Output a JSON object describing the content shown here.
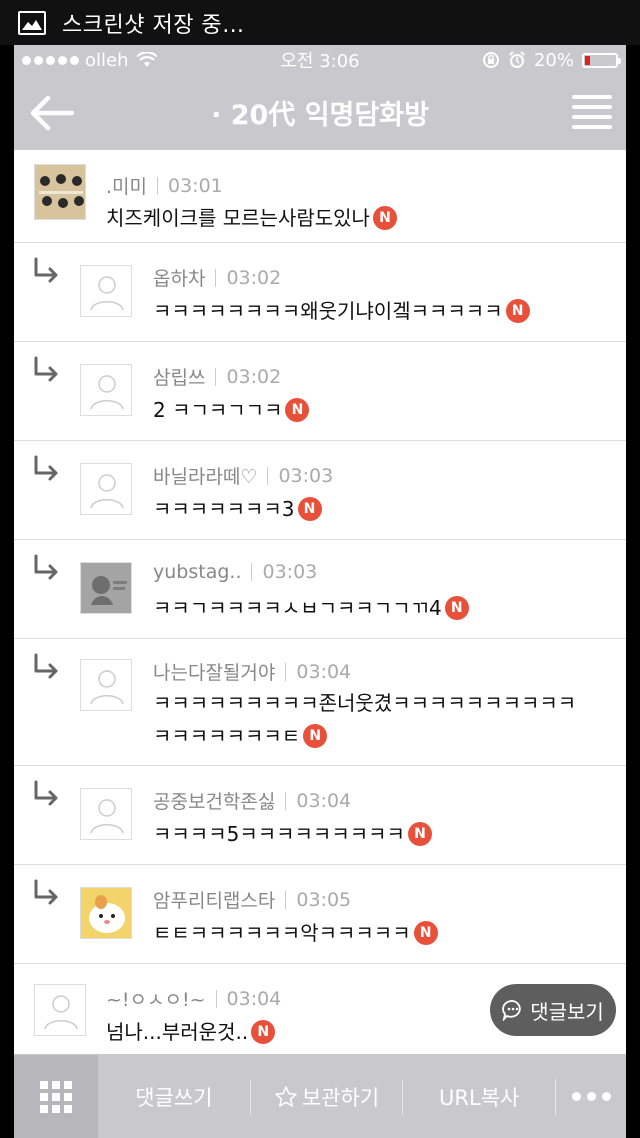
{
  "notification": {
    "text": "스크린샷 저장 중…"
  },
  "status": {
    "carrier": "olleh",
    "time": "오전 3:06",
    "battery": "20%"
  },
  "nav": {
    "title": "· 20代 익명담화방"
  },
  "comments": [
    {
      "name": ".미미",
      "time": "03:01",
      "text": "치즈케이크를 모르는사람도있나",
      "reply": false,
      "avatar": "photo"
    },
    {
      "name": "옵하차",
      "time": "03:02",
      "text": "ㅋㅋㅋㅋㅋㅋㅋㅋ왜웃기냐이겤ㅋㅋㅋㅋㅋ",
      "reply": true,
      "avatar": "default"
    },
    {
      "name": "삼립쓰",
      "time": "03:02",
      "text": "2 ㅋㄱㅋㄱㄱㅋ",
      "reply": true,
      "avatar": "default"
    },
    {
      "name": "바닐라라떼♡",
      "time": "03:03",
      "text": "ㅋㅋㅋㅋㅋㅋㅋ3",
      "reply": true,
      "avatar": "default"
    },
    {
      "name": "yubstag..",
      "time": "03:03",
      "text": "ㅋㅋㄱㅋㅋㅋㅋㅅㅂㄱㅋㅋㄱㄱㄲ4",
      "reply": true,
      "avatar": "gray"
    },
    {
      "name": "나는다잘될거야",
      "time": "03:04",
      "text": "ㅋㅋㅋㅋㅋㅋㅋㅋㅋ존너웃겼ㅋㅋㅋㅋㅋㅋㅋㅋㅋㅋㅋㅋㅋㅋㅋㅋㅋㅌ",
      "reply": true,
      "avatar": "default"
    },
    {
      "name": "공중보건학존싫",
      "time": "03:04",
      "text": "ㅋㅋㅋㅋ5ㅋㅋㅋㅋㅋㅋㅋㅋㅋ",
      "reply": true,
      "avatar": "default"
    },
    {
      "name": "암푸리티랩스타",
      "time": "03:05",
      "text": "ㅌㅌㅋㅋㅋㅋㅋㅋ악ㅋㅋㅋㅋㅋ",
      "reply": true,
      "avatar": "hamster"
    },
    {
      "name": "~!ㅇㅅㅇ!~",
      "time": "03:04",
      "text": "넘나...부러운것..",
      "reply": false,
      "avatar": "default"
    }
  ],
  "new_badge": "N",
  "view_comments": "댓글보기",
  "toolbar": {
    "write": "댓글쓰기",
    "save": "보관하기",
    "copy_url": "URL복사"
  },
  "colors": {
    "accent": "#e8503a",
    "bar": "#c9c9cd"
  }
}
